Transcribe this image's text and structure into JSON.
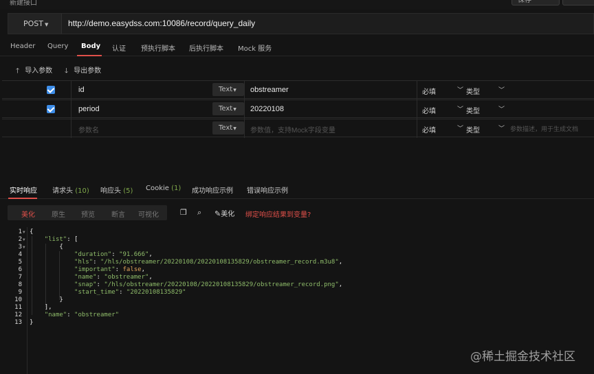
{
  "window": {
    "title": "新建接口",
    "save_label": "保存",
    "close_label": ""
  },
  "request": {
    "method": "POST",
    "url": "http://demo.easydss.com:10086/record/query_daily"
  },
  "request_tabs": [
    "Header",
    "Query",
    "Body",
    "认证",
    "预执行脚本",
    "后执行脚本",
    "Mock 服务"
  ],
  "active_request_tab": "Body",
  "param_actions": {
    "import": "导入参数",
    "export": "导出参数"
  },
  "params": [
    {
      "checked": true,
      "name": "id",
      "type": "Text",
      "value": "obstreamer",
      "required": "必填",
      "type_label": "类型",
      "desc": ""
    },
    {
      "checked": true,
      "name": "period",
      "type": "Text",
      "value": "20220108",
      "required": "必填",
      "type_label": "类型",
      "desc": ""
    },
    {
      "checked": false,
      "name": "参数名",
      "type": "Text",
      "value": "参数值，支持Mock字段变量",
      "required": "必填",
      "type_label": "类型",
      "desc": "参数描述，用于生成文档"
    }
  ],
  "response_tabs": [
    {
      "label": "实时响应",
      "count": ""
    },
    {
      "label": "请求头",
      "count": "(10)"
    },
    {
      "label": "响应头",
      "count": "(5)"
    },
    {
      "label": "Cookie",
      "count": "(1)"
    },
    {
      "label": "成功响应示例",
      "count": ""
    },
    {
      "label": "错误响应示例",
      "count": ""
    }
  ],
  "view_modes": [
    "美化",
    "原生",
    "预览",
    "断言",
    "可视化"
  ],
  "active_view_mode": "美化",
  "toolbar": {
    "beautify": "美化",
    "bind_link": "绑定响应结果到变量?"
  },
  "response_json": {
    "lines": [
      "{",
      "    \"list\": [",
      "        {",
      "            \"duration\": \"91.666\",",
      "            \"hls\": \"/hls/obstreamer/20220108/20220108135829/obstreamer_record.m3u8\",",
      "            \"important\": false,",
      "            \"name\": \"obstreamer\",",
      "            \"snap\": \"/hls/obstreamer/20220108/20220108135829/obstreamer_record.png\",",
      "            \"start_time\": \"20220108135829\"",
      "        }",
      "    ],",
      "    \"name\": \"obstreamer\"",
      "}"
    ]
  },
  "watermark": "@稀土掘金技术社区",
  "colors": {
    "accent": "#e0504a",
    "checkbox": "#3e8ee9",
    "json_string": "#8fbc6a",
    "json_bool": "#e0a55c"
  }
}
